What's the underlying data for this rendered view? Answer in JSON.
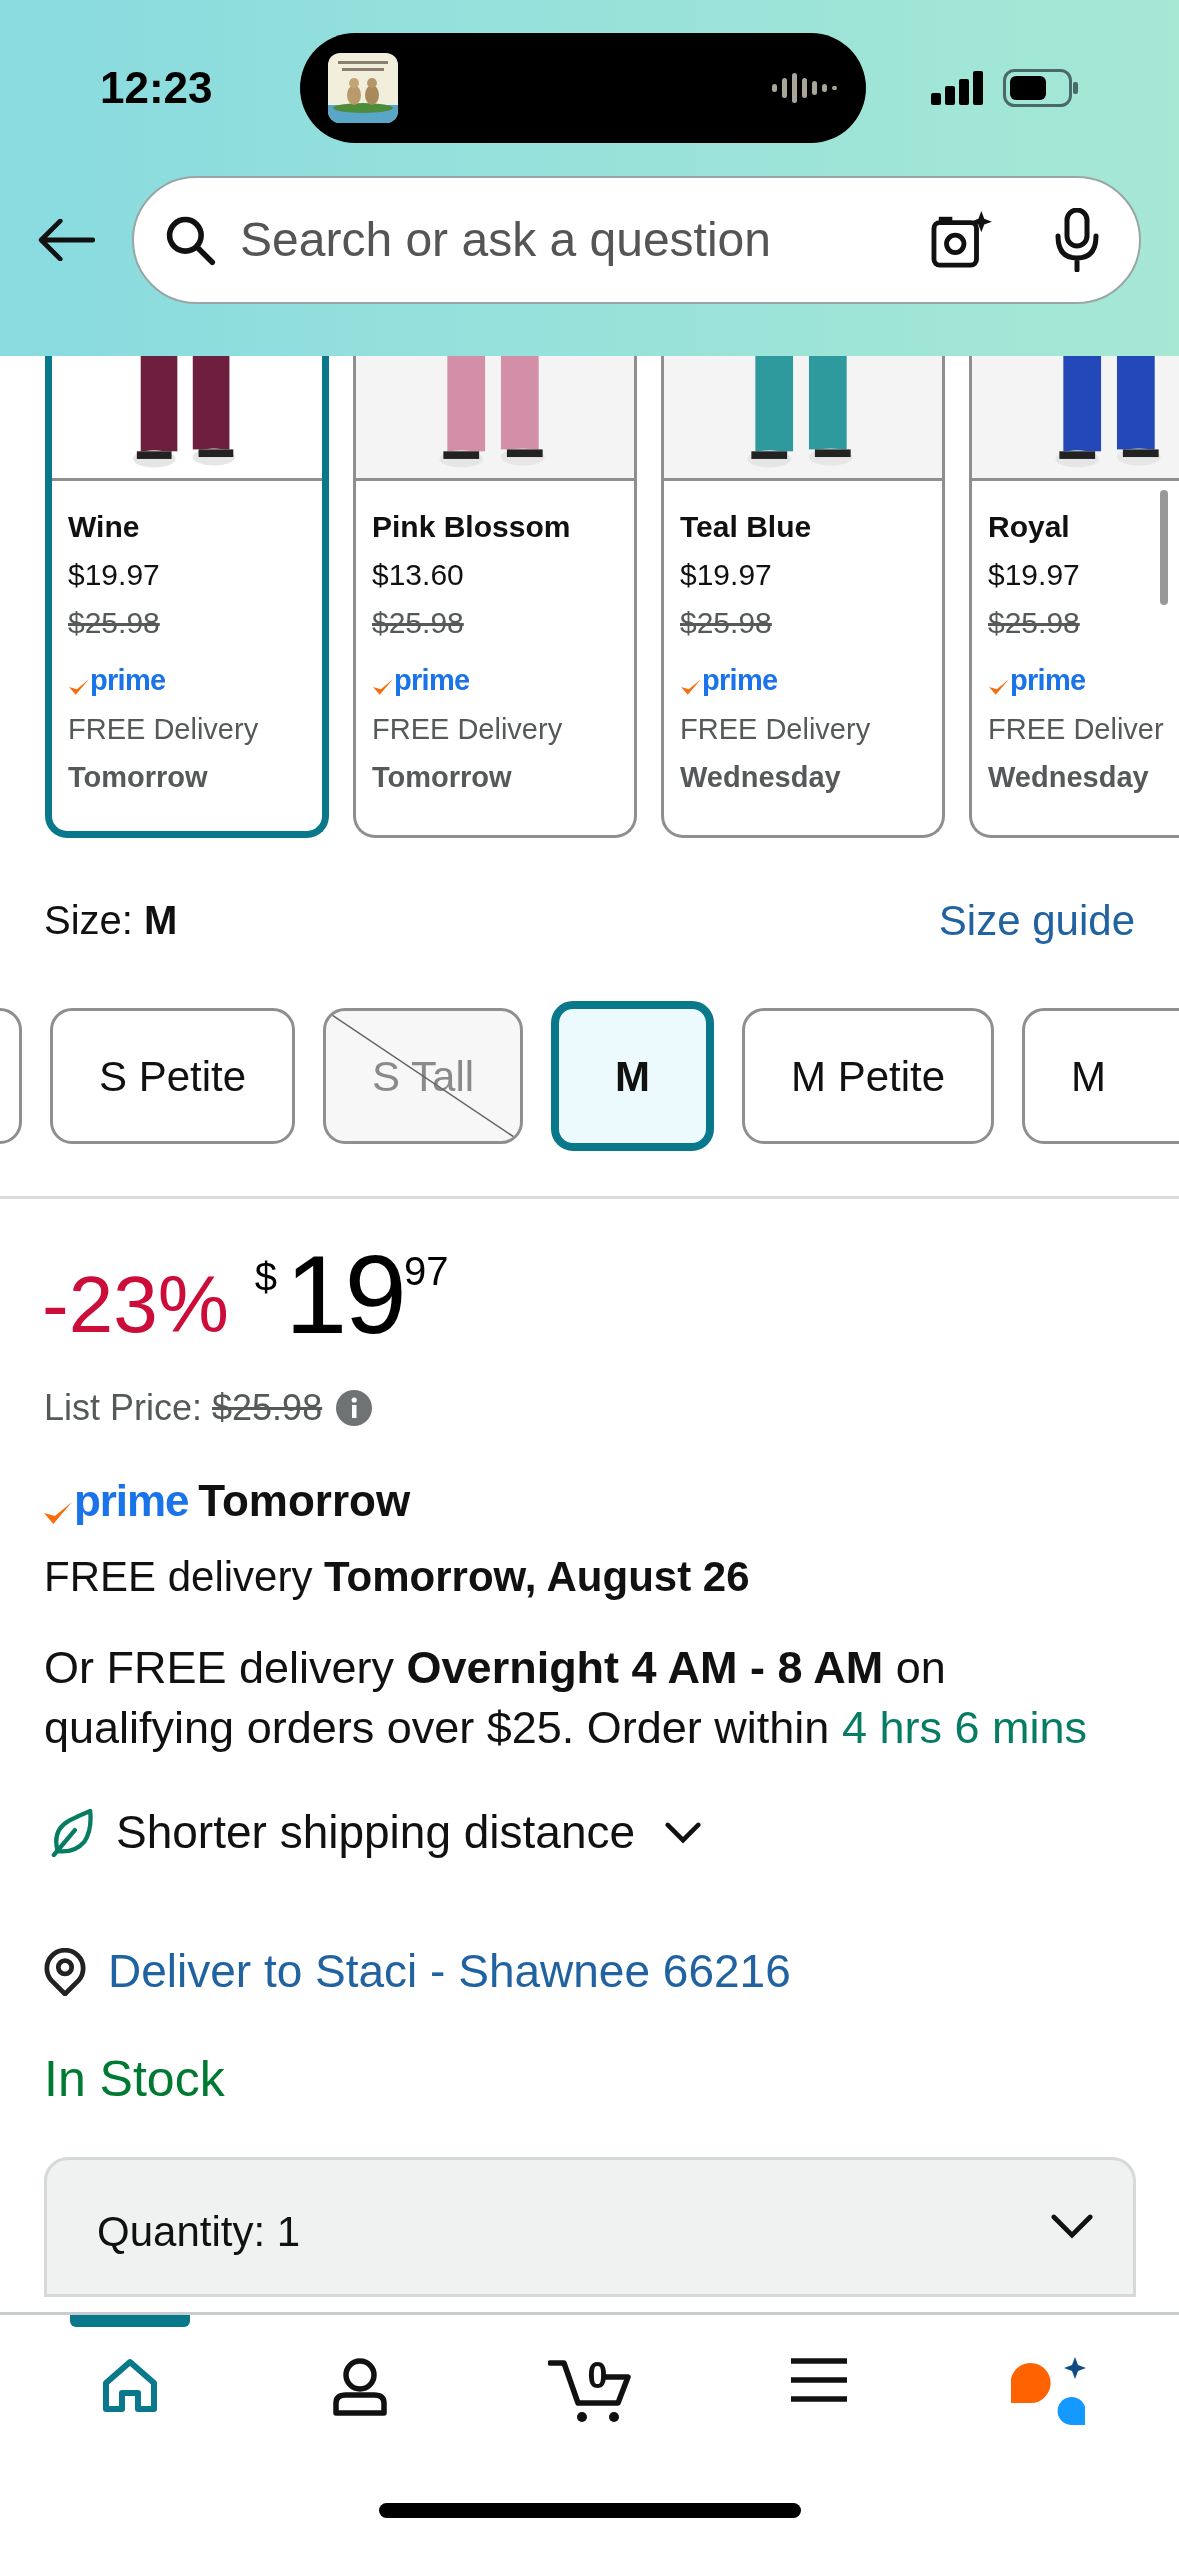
{
  "status_bar": {
    "time": "12:23"
  },
  "search": {
    "placeholder": "Search or ask a question"
  },
  "color_options": [
    {
      "name": "Wine",
      "price": "$19.97",
      "list_price": "$25.98",
      "badge": "prime",
      "delivery": "FREE Delivery",
      "day": "Tomorrow",
      "selected": true
    },
    {
      "name": "Pink Blossom",
      "price": "$13.60",
      "list_price": "$25.98",
      "badge": "prime",
      "delivery": "FREE Delivery",
      "day": "Tomorrow",
      "selected": false
    },
    {
      "name": "Teal Blue",
      "price": "$19.97",
      "list_price": "$25.98",
      "badge": "prime",
      "delivery": "FREE Delivery",
      "day": "Wednesday",
      "selected": false
    },
    {
      "name": "Royal",
      "price": "$19.97",
      "list_price": "$25.98",
      "badge": "prime",
      "delivery": "FREE Deliver",
      "day": "Wednesday",
      "selected": false
    }
  ],
  "size": {
    "label": "Size:",
    "value": "M",
    "guide": "Size guide"
  },
  "sizes": [
    {
      "kind": "partial"
    },
    {
      "kind": "option",
      "label": "S Petite",
      "selected": false,
      "available": true
    },
    {
      "kind": "option",
      "label": "S Tall",
      "selected": false,
      "available": false
    },
    {
      "kind": "option",
      "label": "M",
      "selected": true,
      "available": true
    },
    {
      "kind": "option",
      "label": "M Petite",
      "selected": false,
      "available": true
    },
    {
      "kind": "option",
      "label": "M",
      "selected": false,
      "available": true
    }
  ],
  "price": {
    "discount": "-23%",
    "currency": "$",
    "whole": "19",
    "fraction": "97",
    "list_label": "List Price:",
    "list_price": "$25.98"
  },
  "prime_delivery": {
    "badge": "prime",
    "day": "Tomorrow"
  },
  "delivery": "FREE delivery **Tomorrow, August 26**",
  "delivery_note": {
    "text": "Or FREE delivery **Overnight 4 AM - 8 AM** on qualifying orders over $25. Order within",
    "countdown": "4 hrs 6 mins"
  },
  "shipping": "Shorter shipping distance",
  "deliver_to": "Deliver to Staci - Shawnee 66216",
  "stock": "In Stock",
  "quantity": {
    "label": "Quantity:",
    "value": "1"
  },
  "nav": [
    {
      "kind": "home",
      "selected": true
    },
    {
      "kind": "account",
      "selected": false
    },
    {
      "kind": "cart",
      "count": "0",
      "selected": false
    },
    {
      "kind": "menu",
      "selected": false
    },
    {
      "kind": "assistant",
      "selected": false
    }
  ]
}
